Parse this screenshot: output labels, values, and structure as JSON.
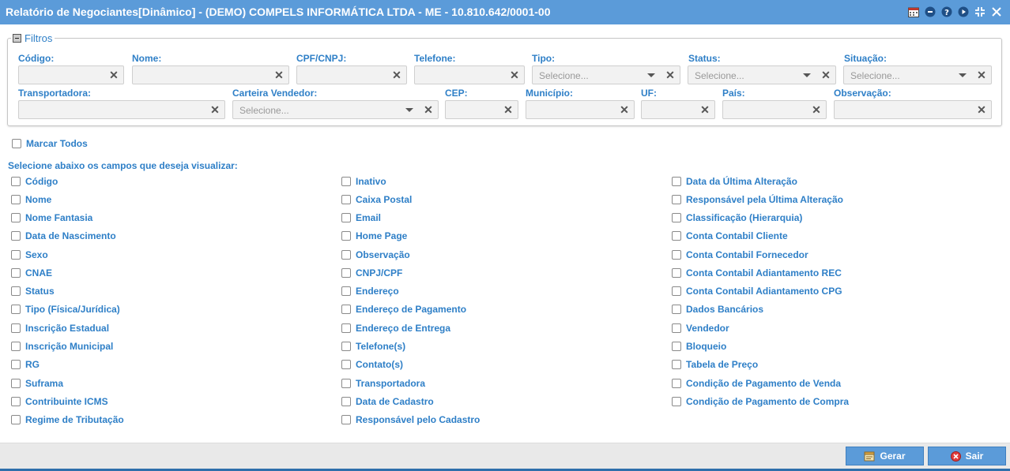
{
  "window": {
    "title": "Relatório de Negociantes[Dinâmico] - (DEMO) COMPELS INFORMÁTICA LTDA - ME - 10.810.642/0001-00",
    "icons": [
      "calendar-icon",
      "minimize-icon",
      "help-icon",
      "play-icon",
      "collapse-icon",
      "close-icon"
    ]
  },
  "filters": {
    "legend": "Filtros",
    "fields": [
      {
        "label": "Código:",
        "placeholder": ""
      },
      {
        "label": "Nome:",
        "placeholder": ""
      },
      {
        "label": "CPF/CNPJ:",
        "placeholder": ""
      },
      {
        "label": "Telefone:",
        "placeholder": ""
      },
      {
        "label": "Tipo:",
        "placeholder": "Selecione..."
      },
      {
        "label": "Status:",
        "placeholder": "Selecione..."
      },
      {
        "label": "Situação:",
        "placeholder": "Selecione..."
      },
      {
        "label": "Transportadora:",
        "placeholder": ""
      },
      {
        "label": "Carteira Vendedor:",
        "placeholder": "Selecione..."
      },
      {
        "label": "CEP:",
        "placeholder": ""
      },
      {
        "label": "Município:",
        "placeholder": ""
      },
      {
        "label": "UF:",
        "placeholder": ""
      },
      {
        "label": "País:",
        "placeholder": ""
      },
      {
        "label": "Observação:",
        "placeholder": ""
      }
    ]
  },
  "select_all": {
    "label": "Marcar Todos",
    "checked": false
  },
  "fields_hint": "Selecione abaixo os campos que deseja visualizar:",
  "columns": [
    [
      "Código",
      "Nome",
      "Nome Fantasia",
      "Data de Nascimento",
      "Sexo",
      "CNAE",
      "Status",
      "Tipo (Física/Jurídica)",
      "Inscrição Estadual",
      "Inscrição Municipal",
      "RG",
      "Suframa",
      "Contribuinte ICMS",
      "Regime de Tributação"
    ],
    [
      "Inativo",
      "Caixa Postal",
      "Email",
      "Home Page",
      "Observação",
      "CNPJ/CPF",
      "Endereço",
      "Endereço de Pagamento",
      "Endereço de Entrega",
      "Telefone(s)",
      "Contato(s)",
      "Transportadora",
      "Data de Cadastro",
      "Responsável pelo Cadastro"
    ],
    [
      "Data da Última Alteração",
      "Responsável pela Última Alteração",
      "Classificação (Hierarquia)",
      "Conta Contabil Cliente",
      "Conta Contabil Fornecedor",
      "Conta Contabil Adiantamento REC",
      "Conta Contabil Adiantamento CPG",
      "Dados Bancários",
      "Vendedor",
      "Bloqueio",
      "Tabela de Preço",
      "Condição de Pagamento de Venda",
      "Condição de Pagamento de Compra"
    ]
  ],
  "buttons": {
    "generate": "Gerar",
    "exit": "Sair"
  },
  "colors": {
    "title_bar": "#5b9bd9",
    "label": "#2e7fc7",
    "button": "#5b9bd9"
  }
}
